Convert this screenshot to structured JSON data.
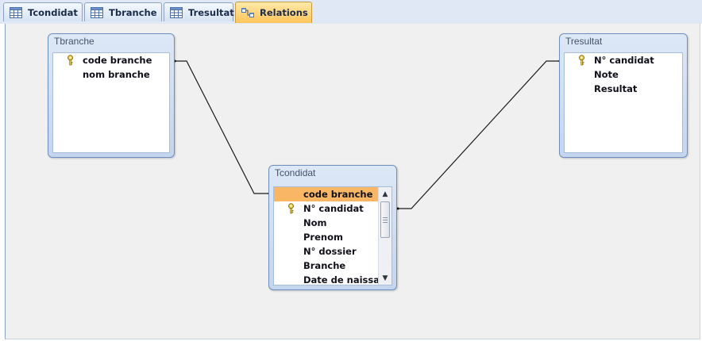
{
  "tabs": [
    {
      "label": "Tcondidat",
      "icon": "table-icon"
    },
    {
      "label": "Tbranche",
      "icon": "table-icon"
    },
    {
      "label": "Tresultat",
      "icon": "table-icon"
    },
    {
      "label": "Relations",
      "icon": "relationships-icon",
      "active": true
    }
  ],
  "tables": {
    "tbranche": {
      "title": "Tbranche",
      "fields": [
        {
          "name": "code branche",
          "primary_key": true
        },
        {
          "name": "nom branche",
          "primary_key": false
        }
      ]
    },
    "tresultat": {
      "title": "Tresultat",
      "fields": [
        {
          "name": "N° candidat",
          "primary_key": true
        },
        {
          "name": "Note",
          "primary_key": false
        },
        {
          "name": "Resultat",
          "primary_key": false
        }
      ]
    },
    "tcondidat": {
      "title": "Tcondidat",
      "fields": [
        {
          "name": "code branche",
          "primary_key": false,
          "selected": true
        },
        {
          "name": "N° candidat",
          "primary_key": true
        },
        {
          "name": "Nom",
          "primary_key": false
        },
        {
          "name": "Prenom",
          "primary_key": false
        },
        {
          "name": "N° dossier",
          "primary_key": false
        },
        {
          "name": "Branche",
          "primary_key": false
        },
        {
          "name": "Date de naissar",
          "primary_key": false
        }
      ]
    }
  },
  "relationships": [
    {
      "from": "Tbranche.code branche",
      "to": "Tcondidat.code branche"
    },
    {
      "from": "Tresultat.N° candidat",
      "to": "Tcondidat.N° candidat"
    }
  ],
  "colors": {
    "active_tab": "#ffc55a",
    "selected_field": "#f9b766",
    "window_frame": "#c4d5ee"
  }
}
